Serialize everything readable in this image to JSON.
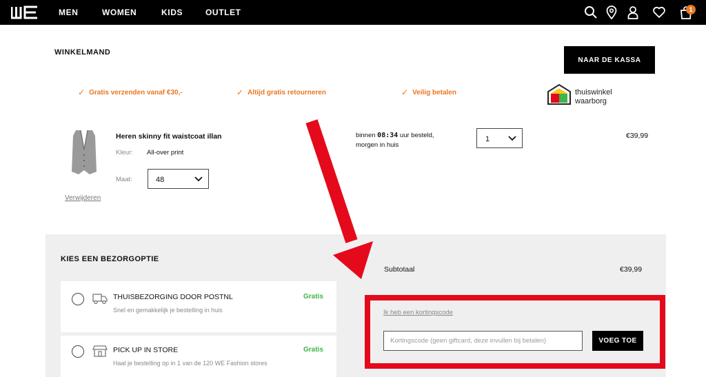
{
  "nav": {
    "logo": "WE",
    "items": [
      "MEN",
      "WOMEN",
      "KIDS",
      "OUTLET"
    ],
    "icons": [
      "search-icon",
      "location-icon",
      "account-icon",
      "heart-icon",
      "bag-icon"
    ],
    "cart_count": "1"
  },
  "page_title": "WINKELMAND",
  "checkout_label": "NAAR DE KASSA",
  "usps": [
    "Gratis verzenden vanaf €30,-",
    "Altijd gratis retourneren",
    "Veilig betalen"
  ],
  "trust_badge": {
    "line1": "thuiswinkel",
    "line2": "waarborg"
  },
  "product": {
    "name": "Heren skinny fit waistcoat illan",
    "color_label": "Kleur:",
    "color_value": "All-over print",
    "size_label": "Maat:",
    "size_value": "48",
    "remove_label": "Verwijderen",
    "delivery_pre": "binnen",
    "delivery_time": "08:34",
    "delivery_post": "uur besteld,",
    "delivery_line2": "morgen in huis",
    "quantity": "1",
    "price": "€39,99"
  },
  "delivery": {
    "title": "KIES EEN BEZORGOPTIE",
    "options": [
      {
        "title": "THUISBEZORGING DOOR POSTNL",
        "subtitle": "Snel en gemakkelijk je bestelling in huis",
        "price": "Gratis",
        "icon": "truck-icon"
      },
      {
        "title": "PICK UP IN STORE",
        "subtitle": "Haal je bestelling op in 1 van de 120 WE Fashion stores",
        "price": "Gratis",
        "icon": "store-icon"
      }
    ]
  },
  "summary": {
    "subtotal_label": "Subtotaal",
    "subtotal_value": "€39,99",
    "discount_link": "Ik heb een kortingscode",
    "discount_placeholder": "Kortingscode (geen giftcard, deze invullen bij betalen)",
    "apply_label": "VOEG TOE"
  },
  "annotation": {
    "arrow_color": "#e5091c",
    "box_color": "#e5091c"
  },
  "colors": {
    "accent": "#e87722",
    "free": "#3db54a",
    "nav_bg": "#000000"
  }
}
